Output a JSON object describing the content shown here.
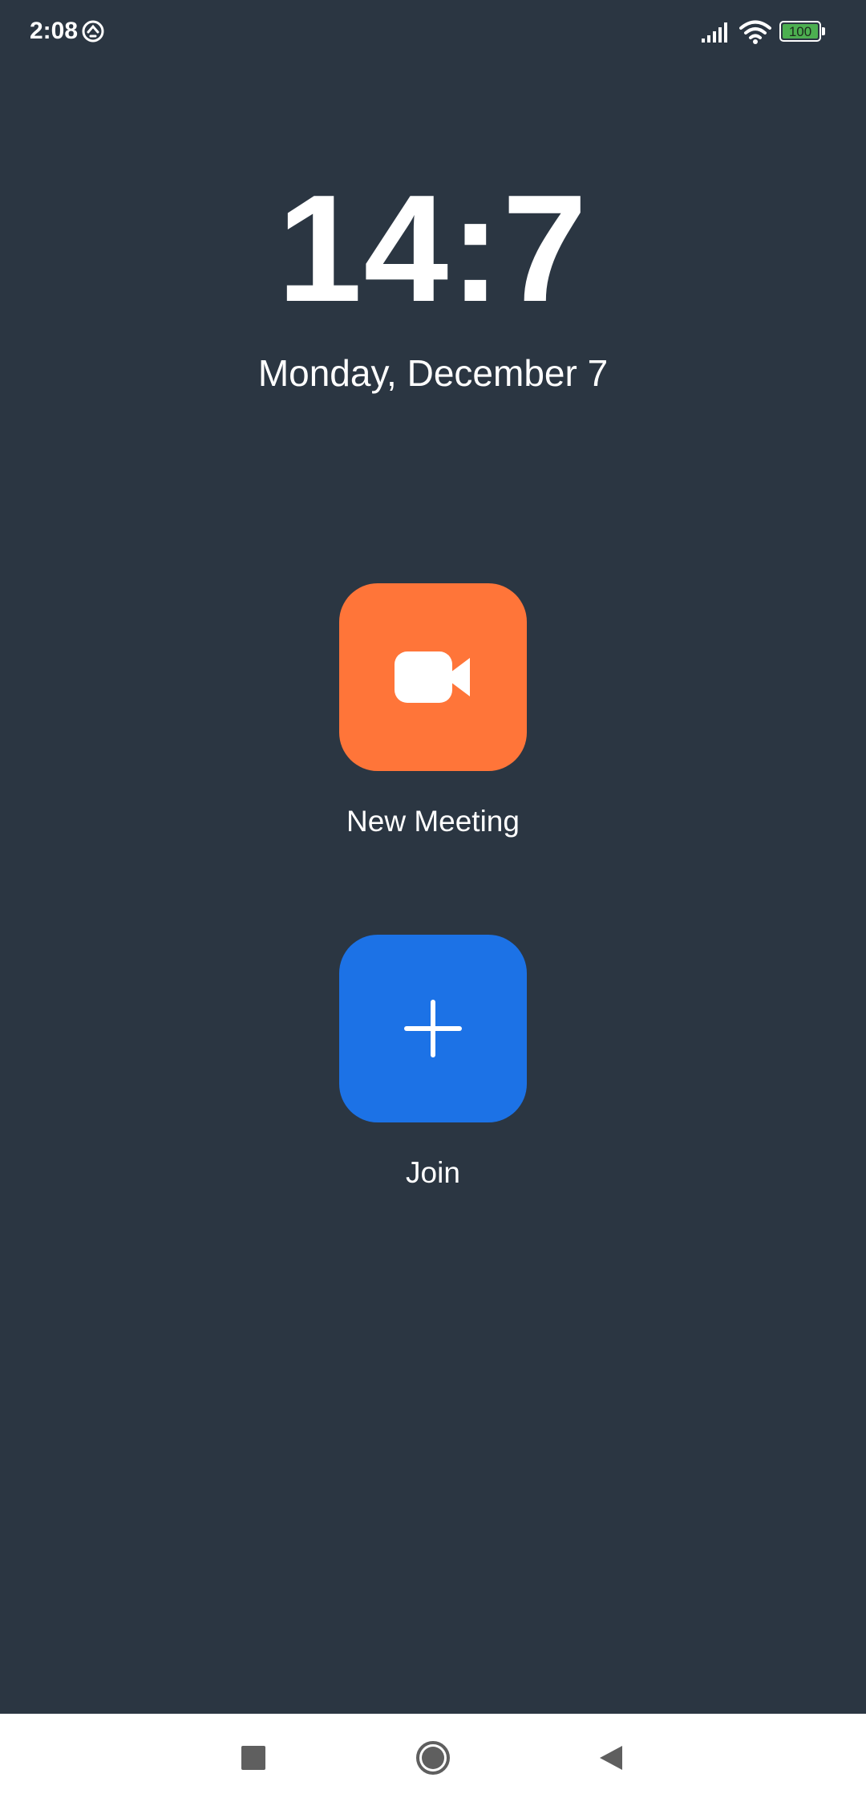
{
  "status_bar": {
    "time": "2:08",
    "battery_level": "100",
    "icons": [
      "sync-icon",
      "signal-icon",
      "wifi-icon",
      "battery-icon"
    ]
  },
  "clock": {
    "time": "14:7",
    "date": "Monday, December 7"
  },
  "actions": {
    "new_meeting": {
      "label": "New Meeting",
      "icon": "video-camera-icon",
      "color": "#ff7539"
    },
    "join": {
      "label": "Join",
      "icon": "plus-icon",
      "color": "#1c72e6"
    }
  },
  "nav_bar": {
    "buttons": [
      "recents-icon",
      "home-icon",
      "back-icon"
    ]
  },
  "colors": {
    "background": "#2b3642",
    "battery_fill": "#4caf50"
  }
}
